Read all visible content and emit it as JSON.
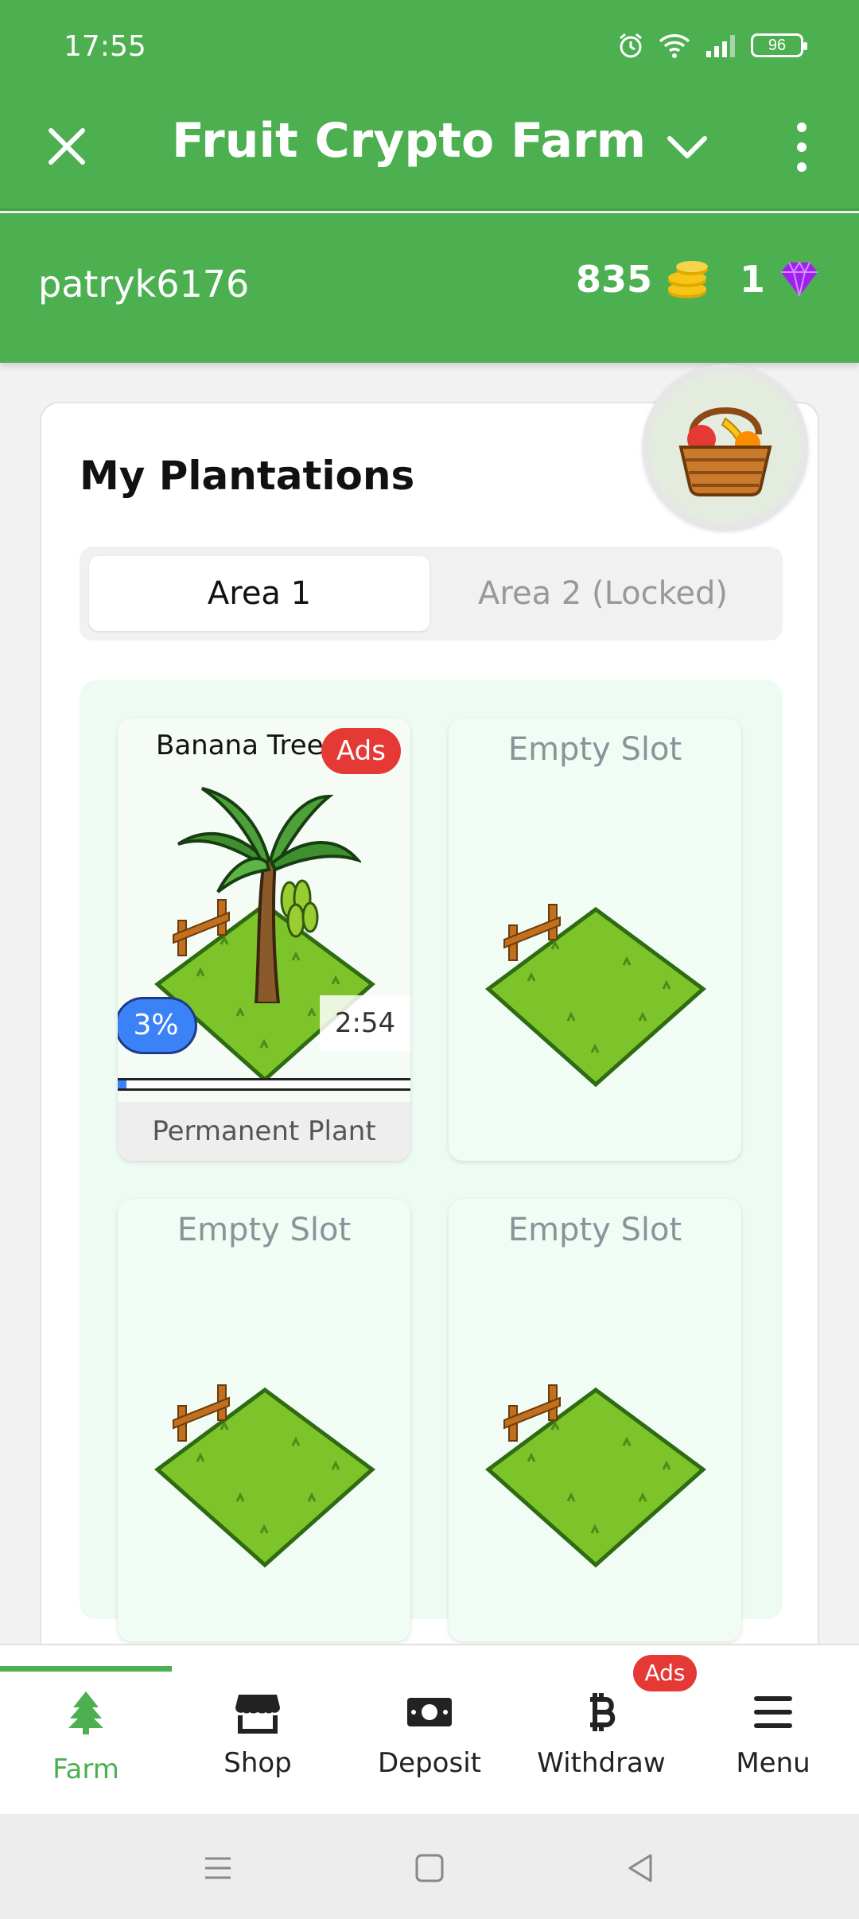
{
  "status_bar": {
    "time": "17:55",
    "battery": "96"
  },
  "app_bar": {
    "title": "Fruit Crypto Farm"
  },
  "user": {
    "username": "patryk6176",
    "coins": "835",
    "gems": "1"
  },
  "plantations": {
    "title": "My Plantations",
    "tabs": [
      {
        "label": "Area 1",
        "active": true
      },
      {
        "label": "Area 2 (Locked)",
        "active": false
      }
    ],
    "slots": [
      {
        "name": "Banana Tree",
        "ads_badge": "Ads",
        "progress_label": "3%",
        "progress": 0.03,
        "timer": "2:54",
        "type_label": "Permanent Plant"
      },
      {
        "label": "Empty Slot"
      },
      {
        "label": "Empty Slot"
      },
      {
        "label": "Empty Slot"
      }
    ]
  },
  "bottom_nav": {
    "items": [
      {
        "label": "Farm",
        "icon": "tree-icon",
        "active": true
      },
      {
        "label": "Shop",
        "icon": "store-icon"
      },
      {
        "label": "Deposit",
        "icon": "money-icon"
      },
      {
        "label": "Withdraw",
        "icon": "bitcoin-icon",
        "badge": "Ads"
      },
      {
        "label": "Menu",
        "icon": "menu-icon"
      }
    ]
  },
  "colors": {
    "primary": "#4caf50",
    "accent_blue": "#3b82f6",
    "badge_red": "#e53935",
    "coin": "#f5c518",
    "gem": "#9c27b0"
  }
}
